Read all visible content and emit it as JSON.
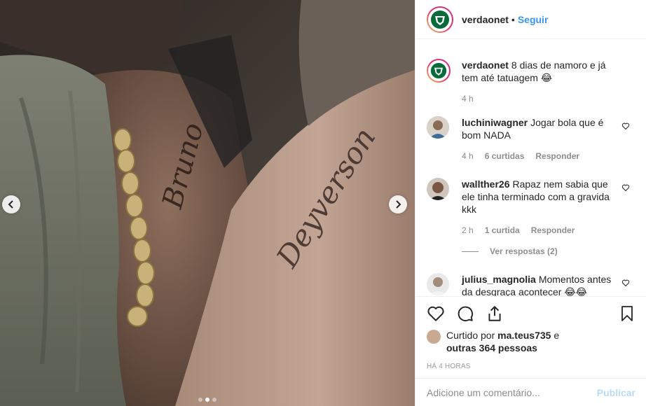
{
  "post": {
    "username": "verdaonet",
    "separator": "•",
    "follow_label": "Seguir",
    "caption": "8 dias de namoro e já tem até tatuagem 😂",
    "caption_time": "4 h",
    "tattoo_left": "Bruno",
    "tattoo_right": "Deyverson"
  },
  "comments": [
    {
      "username": "luchiniwagner",
      "text": "Jogar bola que é bom NADA",
      "time": "4 h",
      "likes": "6 curtidas",
      "reply": "Responder"
    },
    {
      "username": "wallther26",
      "text": "Rapaz nem sabia que ele tinha terminado com a gravida kkk",
      "time": "2 h",
      "likes": "1 curtida",
      "reply": "Responder",
      "view_replies": "Ver respostas (2)"
    },
    {
      "username": "julius_magnolia",
      "text": "Momentos antes da desgraça acontecer 😂😂"
    }
  ],
  "likes_info": {
    "prefix": "Curtido por",
    "first_user": "ma.teus735",
    "conj": "e",
    "others": "outras 364 pessoas"
  },
  "posted_ago": "HÁ 4 HORAS",
  "composer": {
    "placeholder": "Adicione um comentário...",
    "publish_label": "Publicar"
  },
  "carousel": {
    "count": 3,
    "active_index": 1
  },
  "colors": {
    "accent": "#3897f0",
    "brand_green": "#0a6b3a",
    "text": "#262626",
    "muted": "#8e8e8e"
  },
  "icons": [
    "chevron-left-icon",
    "chevron-right-icon",
    "heart-icon",
    "comment-icon",
    "share-icon",
    "bookmark-icon"
  ]
}
